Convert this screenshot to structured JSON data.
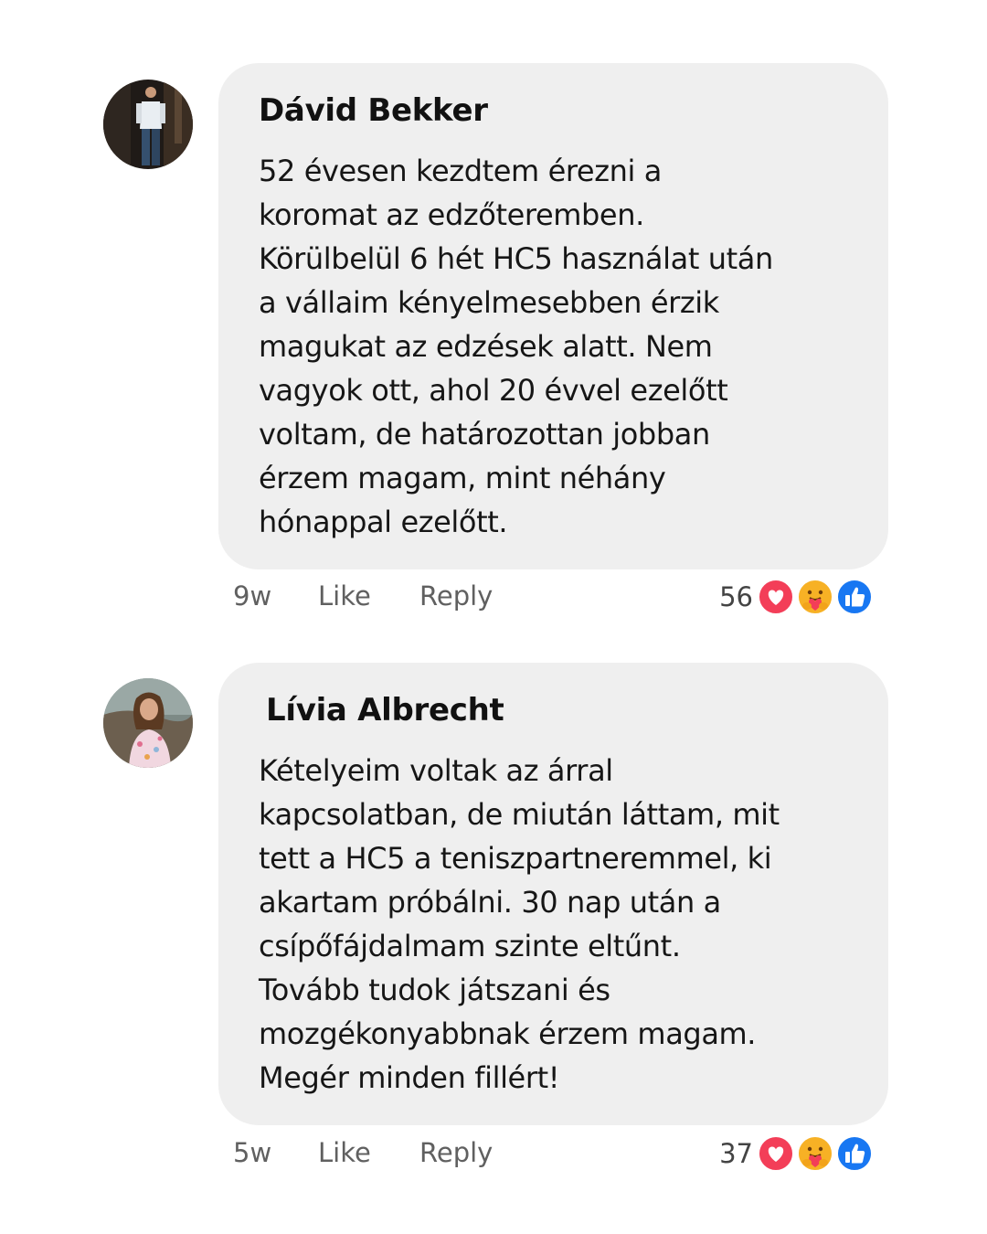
{
  "comments": [
    {
      "author": "Dávid Bekker",
      "lines": [
        "52 évesen kezdtem érezni a",
        "koromat az edzőteremben.",
        "Körülbelül 6 hét HC5 használat után",
        "a vállaim kényelmesebben érzik",
        "magukat az edzések alatt. Nem",
        "vagyok ott, ahol 20 évvel ezelőtt",
        "voltam, de határozottan jobban",
        "érzem magam, mint néhány",
        "hónappal ezelőtt."
      ],
      "time": "9w",
      "like_label": "Like",
      "reply_label": "Reply",
      "reaction_count": "56",
      "reactions": [
        "heart-icon",
        "care-icon",
        "thumbs-up-icon"
      ]
    },
    {
      "author": "Lívia Albrecht",
      "lines": [
        "Kételyeim voltak az árral",
        "kapcsolatban, de miután láttam, mit",
        "tett a HC5 a teniszpartneremmel, ki",
        "akartam próbálni. 30 nap után a",
        "csípőfájdalmam szinte eltűnt.",
        "Tovább tudok játszani és",
        "mozgékonyabbnak érzem magam.",
        "Megér minden fillért!"
      ],
      "time": "5w",
      "like_label": "Like",
      "reply_label": "Reply",
      "reaction_count": "37",
      "reactions": [
        "heart-icon",
        "care-icon",
        "thumbs-up-icon"
      ]
    }
  ],
  "colors": {
    "bubble": "#efefef",
    "meta_text": "#606060",
    "heart": "#f33e58",
    "care": "#f7b125",
    "like": "#1877f2"
  }
}
